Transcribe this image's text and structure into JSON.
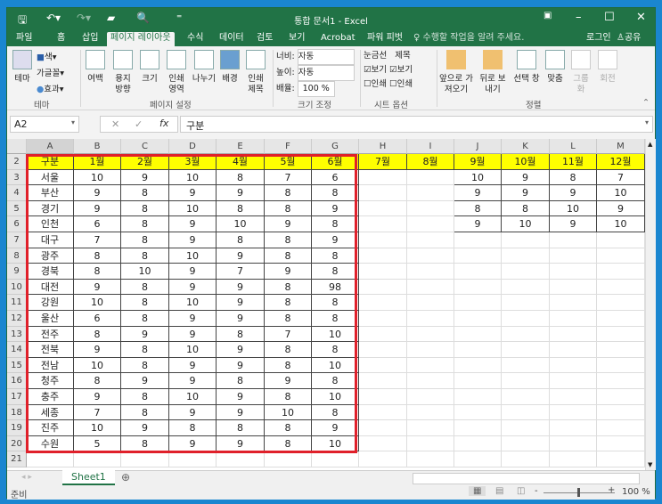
{
  "window": {
    "title": "통합 문서1 - Excel"
  },
  "tabs": [
    "파일",
    "홈",
    "삽입",
    "페이지 레이아웃",
    "수식",
    "데이터",
    "검토",
    "보기",
    "Acrobat",
    "파워 피벗"
  ],
  "tell_me": "수행할 작업을 알려 주세요.",
  "login": "로그인",
  "share": "공유",
  "ribbon": {
    "theme": {
      "theme": "테마",
      "colors": "색",
      "fonts": "글꼴",
      "effects": "효과",
      "group": "테마"
    },
    "page_setup": {
      "margins": "여백",
      "orientation": "용지 방향",
      "size": "크기",
      "print_area": "인쇄 영역",
      "breaks": "나누기",
      "background": "배경",
      "print_titles": "인쇄 제목",
      "group": "페이지 설정"
    },
    "scale": {
      "width_label": "너비:",
      "width_value": "자동",
      "height_label": "높이:",
      "height_value": "자동",
      "scale_label": "배율:",
      "scale_value": "100 %",
      "group": "크기 조정"
    },
    "sheet_options": {
      "gridlines": "눈금선",
      "headings": "제목",
      "view": "보기",
      "print": "인쇄",
      "group": "시트 옵션"
    },
    "arrange": {
      "bring_forward": "앞으로 가져오기",
      "send_backward": "뒤로 보내기",
      "selection_pane": "선택 창",
      "align": "맞춤",
      "group_btn": "그룹화",
      "rotate": "회전",
      "group": "정렬"
    }
  },
  "formula_bar": {
    "name_box": "A2",
    "content": "구분"
  },
  "columns": [
    "A",
    "B",
    "C",
    "D",
    "E",
    "F",
    "G",
    "H",
    "I",
    "J",
    "K",
    "L",
    "M"
  ],
  "header_row": [
    "구분",
    "1월",
    "2월",
    "3월",
    "4월",
    "5월",
    "6월",
    "7월",
    "8월",
    "9월",
    "10월",
    "11월",
    "12월"
  ],
  "rows": [
    [
      "서울",
      "10",
      "9",
      "10",
      "8",
      "7",
      "6",
      "",
      "",
      "10",
      "9",
      "8",
      "7"
    ],
    [
      "부산",
      "9",
      "8",
      "9",
      "9",
      "8",
      "8",
      "",
      "",
      "9",
      "9",
      "9",
      "10"
    ],
    [
      "경기",
      "9",
      "8",
      "10",
      "8",
      "8",
      "9",
      "",
      "",
      "8",
      "8",
      "10",
      "9"
    ],
    [
      "인천",
      "6",
      "8",
      "9",
      "10",
      "9",
      "8",
      "",
      "",
      "9",
      "10",
      "9",
      "10"
    ],
    [
      "대구",
      "7",
      "8",
      "9",
      "8",
      "8",
      "9"
    ],
    [
      "광주",
      "8",
      "8",
      "10",
      "9",
      "8",
      "8"
    ],
    [
      "경북",
      "8",
      "10",
      "9",
      "7",
      "9",
      "8"
    ],
    [
      "대전",
      "9",
      "8",
      "9",
      "9",
      "8",
      "98"
    ],
    [
      "강원",
      "10",
      "8",
      "10",
      "9",
      "8",
      "8"
    ],
    [
      "울산",
      "6",
      "8",
      "9",
      "9",
      "8",
      "8"
    ],
    [
      "전주",
      "8",
      "9",
      "9",
      "8",
      "7",
      "10"
    ],
    [
      "전북",
      "9",
      "8",
      "10",
      "9",
      "8",
      "8"
    ],
    [
      "전남",
      "10",
      "8",
      "9",
      "9",
      "8",
      "10"
    ],
    [
      "청주",
      "8",
      "9",
      "9",
      "8",
      "9",
      "8"
    ],
    [
      "충주",
      "9",
      "8",
      "10",
      "9",
      "8",
      "10"
    ],
    [
      "세종",
      "7",
      "8",
      "9",
      "9",
      "10",
      "8"
    ],
    [
      "진주",
      "10",
      "9",
      "8",
      "8",
      "8",
      "9"
    ],
    [
      "수원",
      "5",
      "8",
      "9",
      "9",
      "8",
      "10"
    ]
  ],
  "sheet_tab": "Sheet1",
  "status": {
    "ready": "준비",
    "zoom": "100 %"
  }
}
